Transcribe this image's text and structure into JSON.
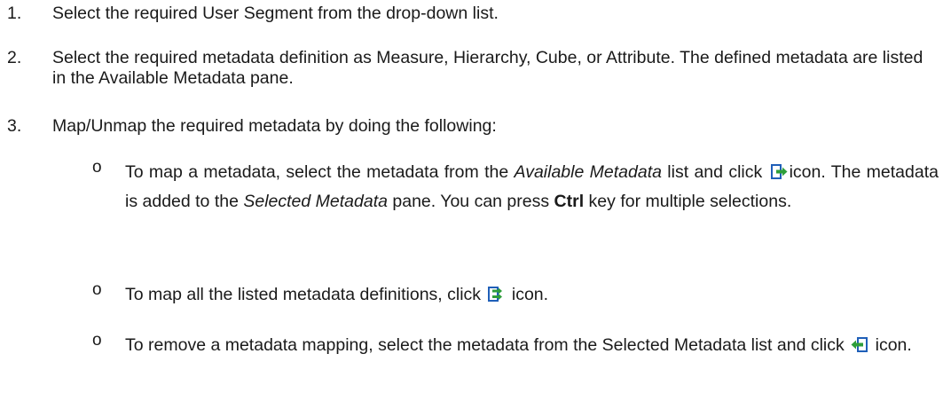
{
  "steps": [
    {
      "number": "1.",
      "text": "Select the required User Segment from the drop-down list."
    },
    {
      "number": "2.",
      "text": "Select the required metadata definition as Measure, Hierarchy, Cube, or Attribute. The defined metadata are listed in the Available Metadata pane."
    },
    {
      "number": "3.",
      "text": "Map/Unmap the required metadata by doing the following:"
    }
  ],
  "sub_items": {
    "bullet": "o",
    "map": {
      "part1": "To map a metadata, select the metadata from the ",
      "available_list": "Available Metadata",
      "part2": " list and click ",
      "icon": "map-arrow-icon",
      "part3": "icon. The metadata is added to the ",
      "selected_pane": "Selected Metadata",
      "part4": " pane. You can press ",
      "key": "Ctrl",
      "part5": " key for multiple selections."
    },
    "map_all": {
      "part1": "To map all the listed metadata definitions, click ",
      "icon": "map-all-icon",
      "part2": " icon."
    },
    "remove": {
      "part1": "To remove a metadata mapping, select the metadata from the Selected Metadata list and click ",
      "icon": "unmap-arrow-icon",
      "part2": " icon."
    }
  },
  "colors": {
    "text": "#1a1a1a",
    "icon_blue": "#1f5fb8",
    "icon_green": "#2e9e3a"
  }
}
